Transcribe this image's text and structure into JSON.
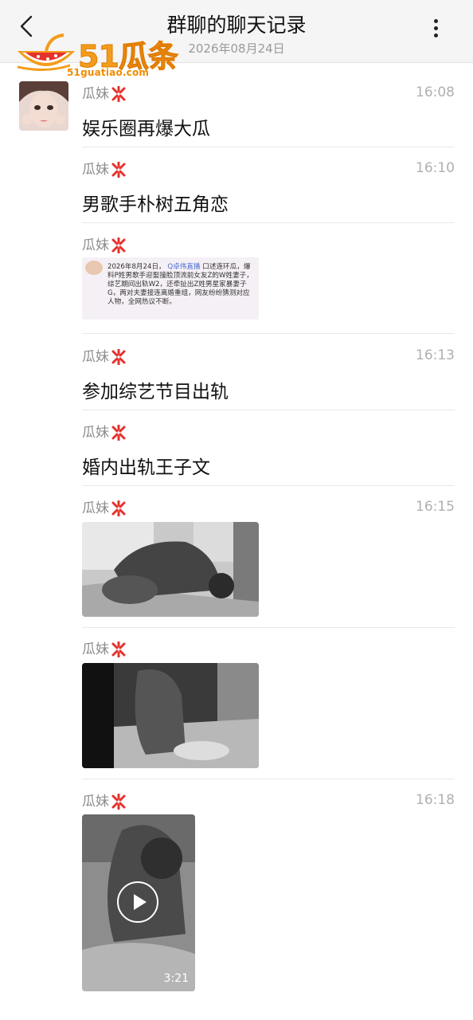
{
  "header": {
    "title": "群聊的聊天记录",
    "date": "2026年08月24日"
  },
  "logo": {
    "text": "51瓜条",
    "url_text": "51guatiao.com"
  },
  "messages": [
    {
      "sender": "瓜妹",
      "time": "16:08",
      "text": "娱乐圈再爆大瓜"
    },
    {
      "sender": "瓜妹",
      "time": "16:10",
      "text": "男歌手朴树五角恋"
    },
    {
      "sender": "瓜妹",
      "time": "",
      "image_caption": {
        "date": "2026年8月24日，",
        "tag": "Q卓伟直播",
        "body": "口述连环瓜，爆料P姓男歌手迎娶撞脸顶流前女友Z的W姓妻子，综艺期间出轨W2，还牵扯出Z姓男星家暴妻子G，两对夫妻接连离婚重组，网友纷纷猜测对应人物，全网热议不断。"
      }
    },
    {
      "sender": "瓜妹",
      "time": "16:13",
      "text": "参加综艺节目出轨"
    },
    {
      "sender": "瓜妹",
      "time": "",
      "text": "婚内出轨王子文"
    },
    {
      "sender": "瓜妹",
      "time": "16:15",
      "media": "photo"
    },
    {
      "sender": "瓜妹",
      "time": "",
      "media": "photo"
    },
    {
      "sender": "瓜妹",
      "time": "16:18",
      "media": "video",
      "duration": "3:21"
    }
  ],
  "colors": {
    "header_bg": "#f5f5f5",
    "accent_logo": "#f39c1c",
    "angry_icon": "#e5322d"
  },
  "icons": [
    "back-chevron-icon",
    "more-vertical-icon",
    "angry-emoji-icon",
    "play-icon"
  ]
}
